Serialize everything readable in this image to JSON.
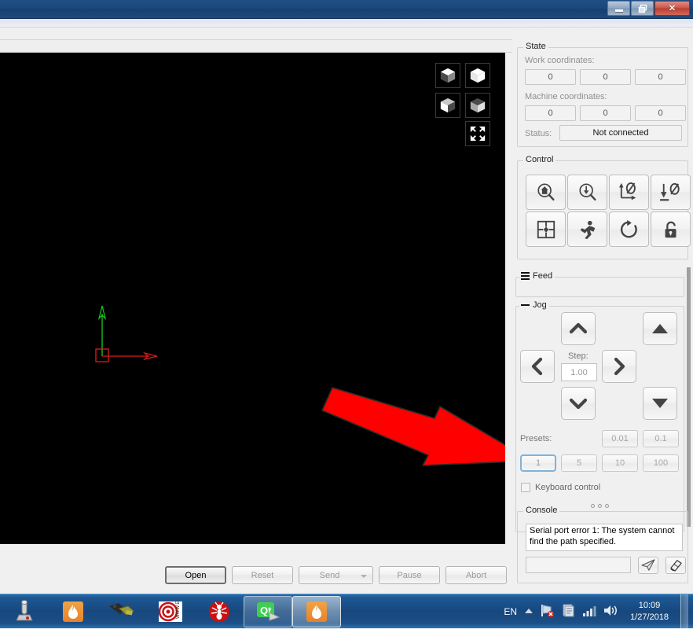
{
  "window": {
    "buttons": {
      "minimize": "minimize",
      "maximize": "restore",
      "close": "✕"
    }
  },
  "viewport": {
    "view_cubes": [
      "view-top-front-left",
      "view-top-front-right",
      "view-isometric-left",
      "view-isometric-right"
    ],
    "fit_button": "fit-to-screen",
    "origin_marker": {
      "x_axis_color": "#e01b1b",
      "y_axis_color": "#18d018",
      "square_color": "#e01b1b"
    },
    "annotation_arrow": {
      "color": "#ff0000",
      "direction": "down-right"
    }
  },
  "actions": {
    "open": "Open",
    "reset": "Reset",
    "send": "Send",
    "pause": "Pause",
    "abort": "Abort"
  },
  "state": {
    "title": "State",
    "work_label": "Work coordinates:",
    "work_values": [
      "0",
      "0",
      "0"
    ],
    "machine_label": "Machine coordinates:",
    "machine_values": [
      "0",
      "0",
      "0"
    ],
    "status_label": "Status:",
    "status_value": "Not connected"
  },
  "control": {
    "title": "Control",
    "buttons": [
      {
        "name": "home-button",
        "icon": "home-search-icon"
      },
      {
        "name": "probe-button",
        "icon": "probe-search-icon"
      },
      {
        "name": "zero-xy-button",
        "icon": "xy-zero-icon"
      },
      {
        "name": "zero-z-button",
        "icon": "z-zero-icon"
      },
      {
        "name": "safe-position-button",
        "icon": "center-target-icon"
      },
      {
        "name": "run-button",
        "icon": "running-man-icon"
      },
      {
        "name": "reset-button",
        "icon": "refresh-icon"
      },
      {
        "name": "unlock-button",
        "icon": "unlock-icon"
      }
    ]
  },
  "feed": {
    "title": "Feed",
    "collapsed": true
  },
  "jog": {
    "title": "Jog",
    "collapsed": false,
    "step_label": "Step:",
    "step_value": "1.00",
    "presets_label": "Presets:",
    "presets_row1": [
      "0.01",
      "0.1"
    ],
    "presets_row2": [
      "1",
      "5",
      "10",
      "100"
    ],
    "active_preset": "1",
    "keyboard_control_label": "Keyboard control",
    "keyboard_control_checked": false,
    "buttons": {
      "up": "jog-y-plus",
      "down": "jog-y-minus",
      "left": "jog-x-minus",
      "right": "jog-x-plus",
      "z_up": "jog-z-plus",
      "z_down": "jog-z-minus"
    }
  },
  "console": {
    "title": "Console",
    "message": "Serial port error 1: The system cannot find the path specified.",
    "input_value": "",
    "send_button": "send-command-button",
    "clear_button": "clear-console-button"
  },
  "taskbar": {
    "items": [
      {
        "name": "taskbar-joystick",
        "icon": "joystick-icon"
      },
      {
        "name": "taskbar-app-1",
        "icon": "flame-icon"
      },
      {
        "name": "taskbar-serial",
        "icon": "serial-connector-icon"
      },
      {
        "name": "taskbar-target",
        "icon": "red-target-icon"
      },
      {
        "name": "taskbar-ant",
        "icon": "red-ant-icon"
      },
      {
        "name": "taskbar-qt",
        "icon": "qt-logo-icon"
      },
      {
        "name": "taskbar-candle",
        "icon": "flame-icon"
      }
    ],
    "tray": {
      "language": "EN",
      "network_icon": "network-disconnected-icon",
      "action_center_icon": "action-center-icon",
      "signal_icon": "signal-bars-icon",
      "volume_icon": "volume-icon",
      "time": "10:09",
      "date": "1/27/2018"
    }
  }
}
